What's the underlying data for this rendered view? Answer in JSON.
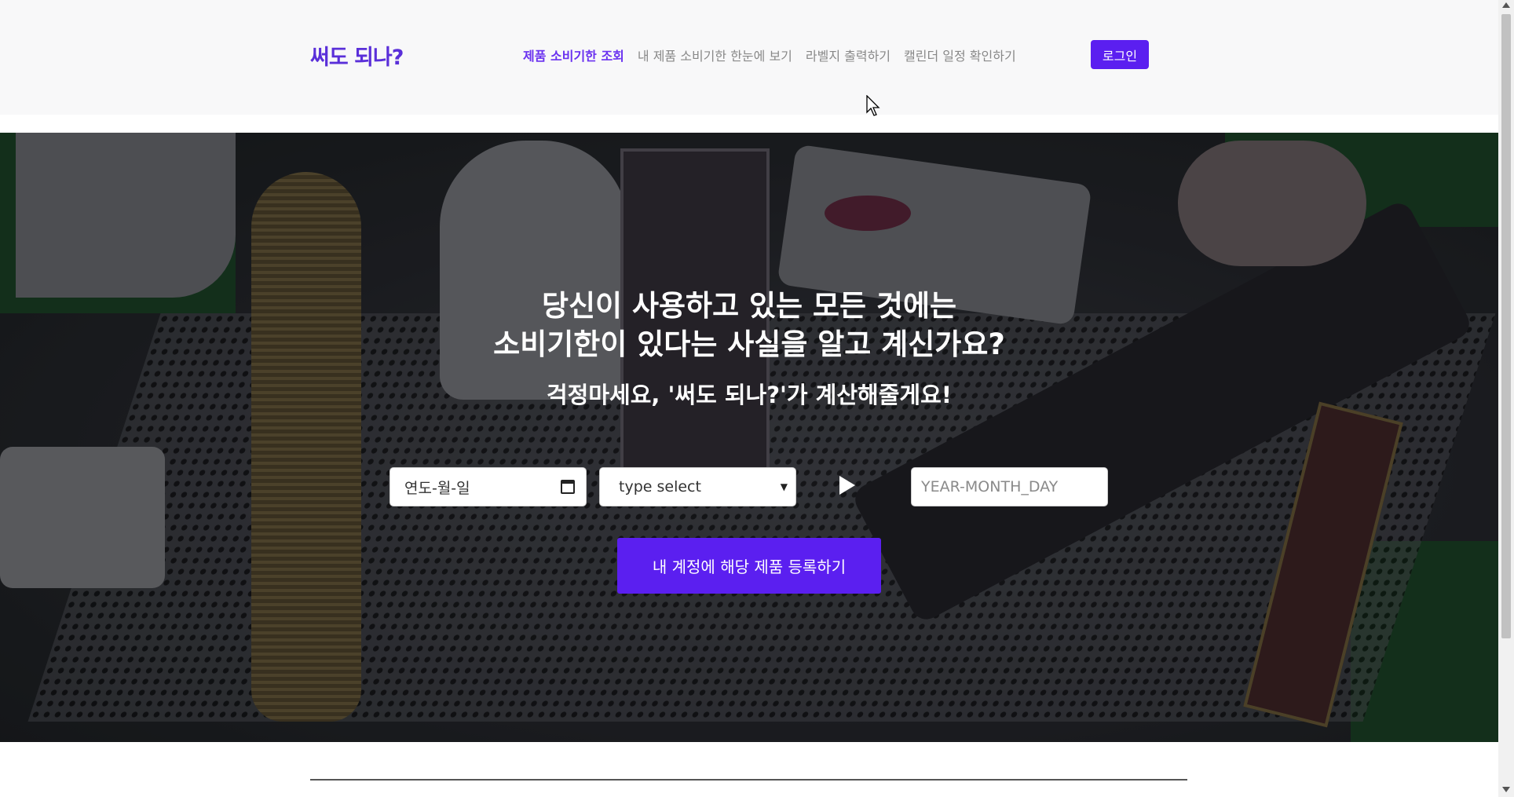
{
  "nav": {
    "brand": "써도 되나?",
    "links": [
      {
        "label": "제품 소비기한 조회",
        "active": true
      },
      {
        "label": "내 제품 소비기한 한눈에 보기"
      },
      {
        "label": "라벨지 출력하기"
      },
      {
        "label": "캘린더 일정 확인하기"
      }
    ],
    "login_label": "로그인"
  },
  "hero": {
    "title_line1": "당신이 사용하고 있는 모든 것에는",
    "title_line2": "소비기한이 있다는 사실을 알고 계신가요?",
    "subtitle": "걱정마세요, '써도 되나?'가 계산해줄게요!",
    "date_placeholder": "연도-월-일",
    "type_select_value": "type select",
    "result_placeholder": "YEAR-MONTH_DAY",
    "register_label": "내 계정에 해당 제품 등록하기"
  },
  "colors": {
    "accent": "#5b1ff0",
    "brand": "#5a2fd9"
  }
}
